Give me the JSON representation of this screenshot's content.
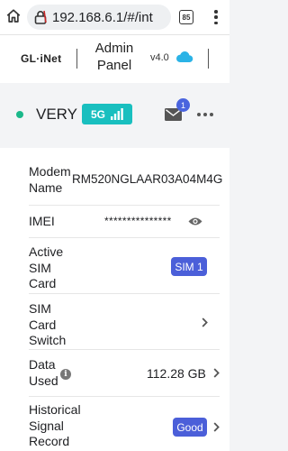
{
  "browser": {
    "url": "192.168.6.1/#/int",
    "tab_count": "85"
  },
  "header": {
    "logo": "GL·iNet",
    "title_line1": "Admin",
    "title_line2": "Panel",
    "version": "v4.0"
  },
  "device": {
    "name": "VERY",
    "network_badge": "5G",
    "notification_count": "1"
  },
  "info_rows": {
    "modem_name": {
      "label_line1": "Modem",
      "label_line2": "Name",
      "value": "RM520NGLAAR03A04M4G"
    },
    "imei": {
      "label": "IMEI",
      "value": "***************"
    },
    "active_sim": {
      "label_line1": "Active",
      "label_line2": "SIM",
      "label_line3": "Card",
      "value": "SIM 1"
    },
    "sim_switch": {
      "label_line1": "SIM",
      "label_line2": "Card",
      "label_line3": "Switch"
    },
    "data_used": {
      "label_line1": "Data",
      "label_line2": "Used",
      "value": "112.28 GB"
    },
    "signal_record": {
      "label_line1": "Historical",
      "label_line2": "Signal",
      "label_line3": "Record",
      "value": "Good"
    }
  },
  "colors": {
    "accent_teal": "#19bfbf",
    "online_green": "#1bb88a",
    "pill_blue": "#4b5fd9",
    "cloud_blue": "#2bb3e6"
  }
}
